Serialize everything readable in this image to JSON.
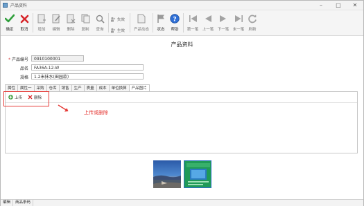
{
  "window": {
    "title": "产品资料"
  },
  "toolbar": {
    "confirm": "确定",
    "cancel": "取消",
    "add": "增加",
    "edit": "编辑",
    "delete": "删除",
    "copy": "复制",
    "query": "查询",
    "lose_effect": "失效",
    "take_effect": "生效",
    "product_dynamic": "产品动态",
    "status": "状态",
    "help": "帮助",
    "first": "第一笔",
    "prev": "上一笔",
    "next": "下一笔",
    "last": "末一笔",
    "refresh": "刷新"
  },
  "form": {
    "heading": "产品资料",
    "product_code_label": "产品编号",
    "product_code_value": "0910100001",
    "name_label": "品名",
    "name_value": "FA36A-12-W",
    "spec_label": "规格",
    "spec_value": "1.2米抹水(田园款)"
  },
  "tabs": [
    {
      "label": "属性"
    },
    {
      "label": "属性一"
    },
    {
      "label": "采购"
    },
    {
      "label": "仓库"
    },
    {
      "label": "销售"
    },
    {
      "label": "生产"
    },
    {
      "label": "质量"
    },
    {
      "label": "成本"
    },
    {
      "label": "单位换算"
    },
    {
      "label": "产品图片"
    }
  ],
  "panel": {
    "upload": "上传",
    "remove": "删除",
    "annotation": "上传或删除"
  },
  "status": {
    "cell1": "编辑",
    "cell2": "商品条码"
  },
  "colors": {
    "accent_red": "#e53935",
    "confirm_green": "#2e9e3a",
    "help_blue": "#2f6fd6"
  }
}
